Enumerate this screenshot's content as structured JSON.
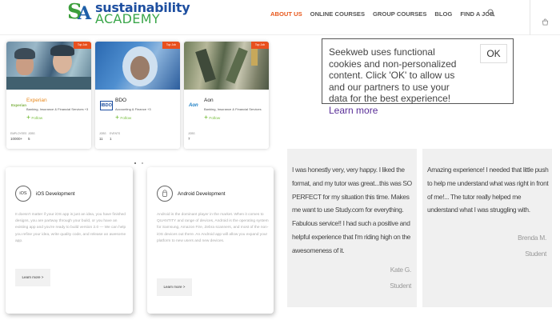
{
  "header": {
    "logo": {
      "line1": "sustainability",
      "line2": "ACADEMY"
    },
    "nav": [
      "ABOUT US",
      "ONLINE COURSES",
      "GROUP COURSES",
      "BLOG",
      "FIND A JOB"
    ],
    "active_nav": "ABOUT US"
  },
  "companies": [
    {
      "tag": "Top Job",
      "logo": "Experian",
      "name": "Experian",
      "sector": "Banking, Insurance & Financial Services +3",
      "follow": "Follow",
      "stats": [
        {
          "label": "EMPLOYEES",
          "value": "10000+"
        },
        {
          "label": "JOBS",
          "value": "5"
        }
      ]
    },
    {
      "tag": "Top Job",
      "logo": "IBDO",
      "name": "BDO",
      "sector": "Accounting & Finance +3",
      "follow": "Follow",
      "stats": [
        {
          "label": "JOBS",
          "value": "11"
        },
        {
          "label": "EVENTS",
          "value": "1"
        }
      ]
    },
    {
      "tag": "Top Job",
      "logo": "Aon",
      "name": "Aon",
      "sector": "Banking, Insurance & Financial Services",
      "follow": "Follow",
      "stats": [
        {
          "label": "JOBS",
          "value": "7"
        }
      ]
    }
  ],
  "dialog": {
    "text": "Seekweb uses functional cookies and non-personalized content. Click 'OK' to allow us and our partners to use your data for the best experience!",
    "link": "Learn more",
    "ok_label": "OK"
  },
  "features": [
    {
      "icon_text": "iOS",
      "title": "iOS Development",
      "description": "It doesn't matter if your iOS app is just an idea, you have finished designs, you are partway through your build, or you have an existing app and you're ready to build version 2.0 — We can help you refine your idea, write quality code, and release an awesome app.",
      "button": "Learn more >"
    },
    {
      "icon_text": "",
      "title": "Android Development",
      "description": "Android is the dominant player in the market. When it comes to QUANTITY and range of devices, Android is the operating system for Samsung, Amazon Fire, Zebra scanners, and most of the non-iOS devices out there. An Android app will allow you expand your platform to new users and new devices.",
      "button": "Learn more >"
    }
  ],
  "testimonials": [
    {
      "text": "I was honestly very, very happy. I liked the format, and my tutor was great...this was SO PERFECT for my situation this time. Makes me want to use Study.com for everything. Fabulous service!! I had such a positive and helpful experience that I'm riding high on the awesomeness of it.",
      "name": "Kate G.",
      "role": "Student"
    },
    {
      "text": "Amazing experience! I needed that little push to help me understand what was right in front of me!... The tutor really helped me understand what I was struggling with.",
      "name": "Brenda M.",
      "role": "Student"
    }
  ],
  "colors": {
    "accent": "#e8581c",
    "follow_green": "#7bc043",
    "brand_blue": "#1e4fa0",
    "brand_green": "#3aa64a",
    "link_purple": "#5a2f98"
  },
  "icons": [
    "search-icon",
    "cart-icon",
    "follow-icon",
    "android-icon"
  ]
}
